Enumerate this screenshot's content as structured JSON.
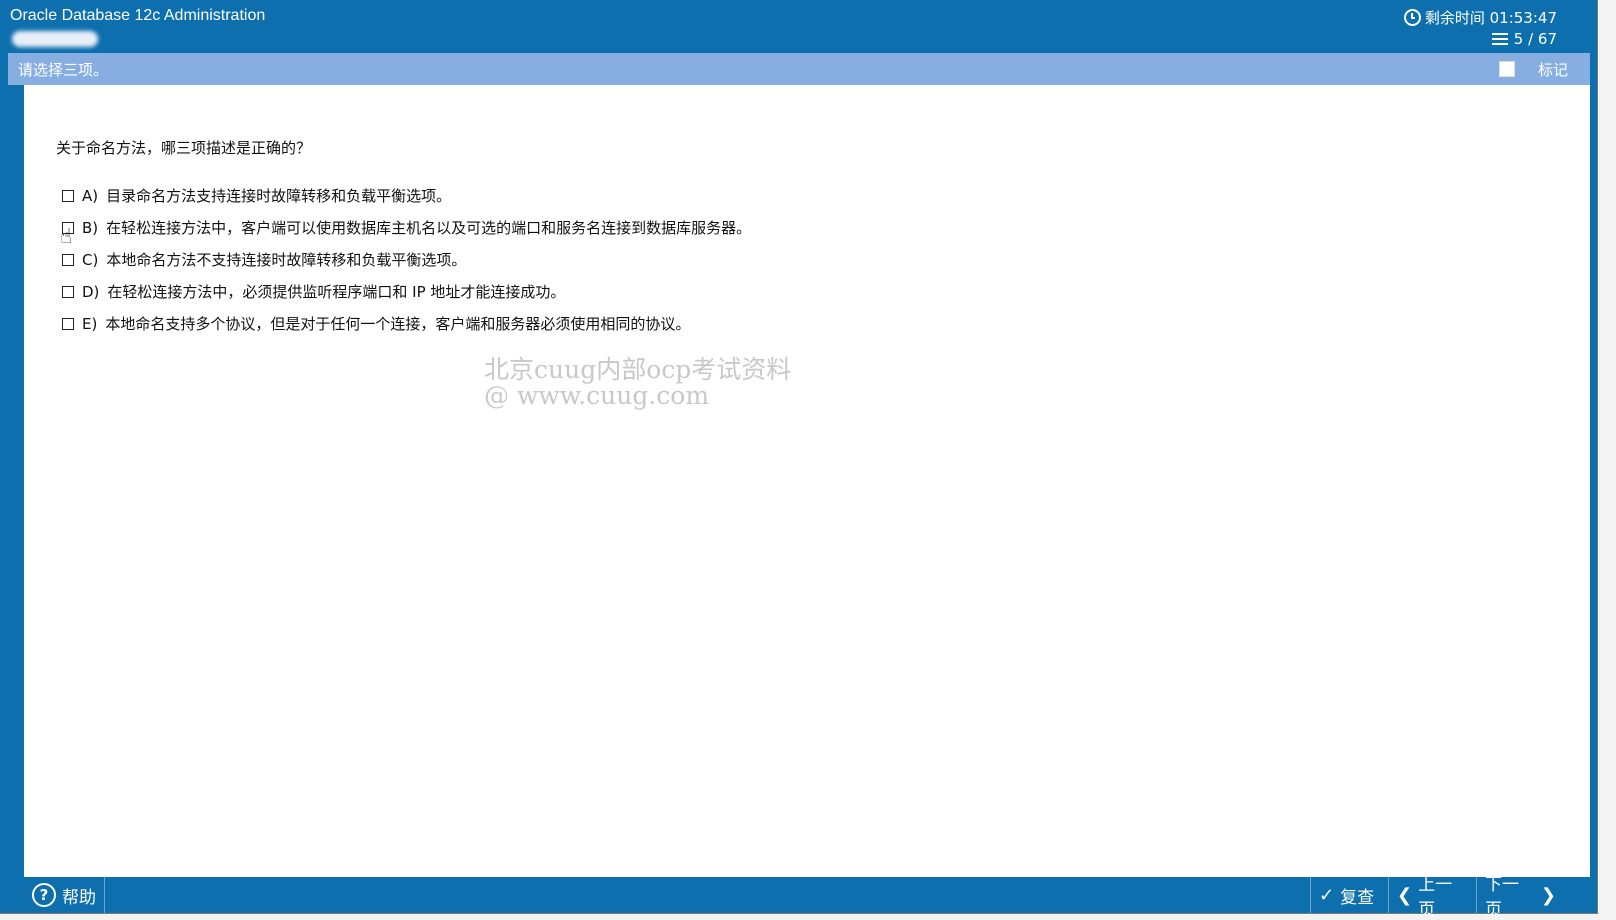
{
  "window": {
    "title": "Oracle Database 12c Administration",
    "timer_label": "剩余时间 01:53:47",
    "progress": "5 / 67"
  },
  "instruction": {
    "text": "请选择三项。",
    "mark_label": "标记"
  },
  "question": {
    "text": "关于命名方法，哪三项描述是正确的？",
    "options": [
      {
        "letter": "A)",
        "text": "目录命名方法支持连接时故障转移和负载平衡选项。",
        "checked": false
      },
      {
        "letter": "B)",
        "text": "在轻松连接方法中，客户端可以使用数据库主机名以及可选的端口和服务名连接到数据库服务器。",
        "checked": false
      },
      {
        "letter": "C)",
        "text": "本地命名方法不支持连接时故障转移和负载平衡选项。",
        "checked": false
      },
      {
        "letter": "D)",
        "text": "在轻松连接方法中，必须提供监听程序端口和 IP 地址才能连接成功。",
        "checked": false
      },
      {
        "letter": "E)",
        "text": "本地命名支持多个协议，但是对于任何一个连接，客户端和服务器必须使用相同的协议。",
        "checked": false
      }
    ]
  },
  "watermark": {
    "line1": "北京cuug内部ocp考试资料",
    "line2": "@ www.cuug.com"
  },
  "footer": {
    "help_label": "帮助",
    "review_label": "复查",
    "prev_label": "上一页",
    "next_label": "下一页"
  },
  "colors": {
    "frame": "#0d6fae",
    "instruction_bar": "#86aee1"
  }
}
